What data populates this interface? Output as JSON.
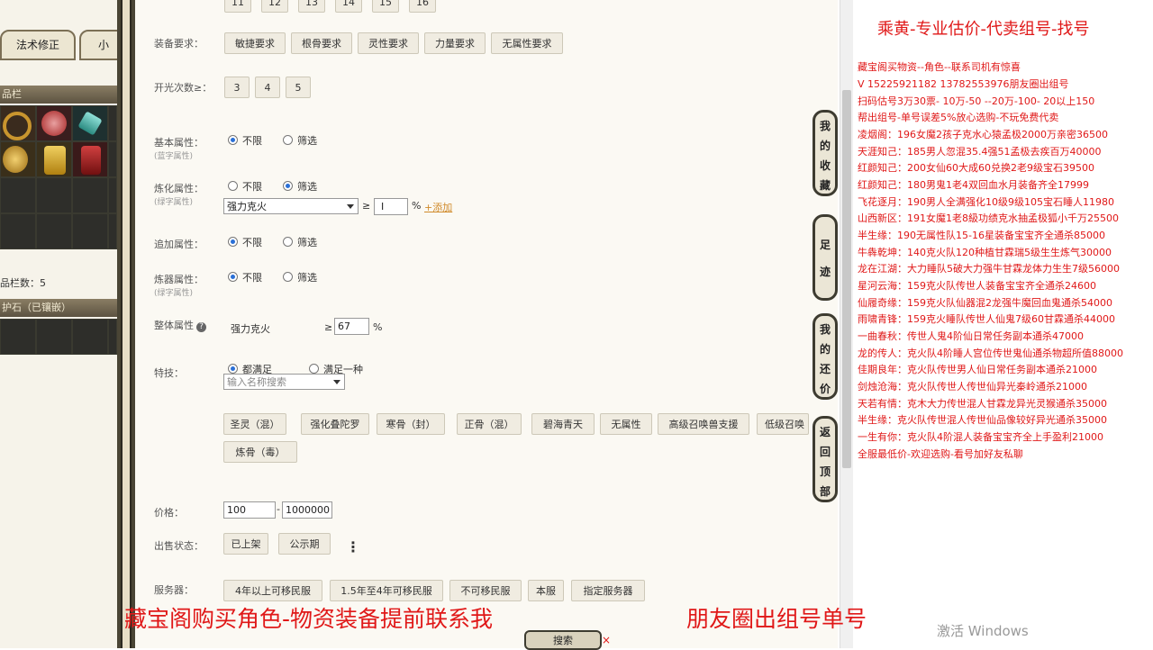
{
  "left_panel": {
    "tab1": "法术修正",
    "tab2": "小",
    "bar1": "品栏",
    "slots_label": "品栏数：5",
    "bar2": "护石（已镶嵌）"
  },
  "form": {
    "top_buttons": [
      "11",
      "12",
      "13",
      "14",
      "15",
      "16"
    ],
    "gear_req": {
      "label": "装备要求：",
      "buttons": [
        "敏捷要求",
        "根骨要求",
        "灵性要求",
        "力量要求",
        "无属性要求"
      ]
    },
    "open_light": {
      "label": "开光次数≥：",
      "buttons": [
        "3",
        "4",
        "5"
      ]
    },
    "basic_attr": {
      "label": "基本属性：",
      "sub": "(蓝字属性)",
      "opt_any": "不限",
      "opt_filter": "筛选"
    },
    "refine_attr": {
      "label": "炼化属性：",
      "sub": "(绿字属性)",
      "opt_any": "不限",
      "opt_filter": "筛选",
      "select_value": "强力克火",
      "ge": "≥",
      "pct": "%",
      "add_link": "+添加"
    },
    "extra_attr": {
      "label": "追加属性：",
      "opt_any": "不限",
      "opt_filter": "筛选"
    },
    "refiner_attr": {
      "label": "炼器属性：",
      "sub": "(绿字属性)",
      "opt_any": "不限",
      "opt_filter": "筛选"
    },
    "overall_attr": {
      "label": "整体属性",
      "help": "?",
      "name": "强力克火",
      "ge": "≥",
      "value": "67",
      "pct": "%"
    },
    "skills": {
      "label": "特技：",
      "opt_all": "都满足",
      "opt_one": "满足一种",
      "search_placeholder": "输入名称搜索",
      "buttons": [
        "圣灵（混）",
        "强化叠陀罗",
        "寒骨（封）",
        "正骨（混）",
        "碧海青天",
        "无属性",
        "高级召唤兽支援",
        "低级召唤",
        "炼骨（毒）"
      ]
    },
    "price": {
      "label": "价格：",
      "min": "100",
      "dash": "-",
      "max": "1000000"
    },
    "sale_status": {
      "label": "出售状态：",
      "buttons": [
        "已上架",
        "公示期"
      ],
      "more": "⋮"
    },
    "server": {
      "label": "服务器：",
      "buttons": [
        "4年以上可移民服",
        "1.5年至4年可移民服",
        "不可移民服",
        "本服",
        "指定服务器"
      ]
    },
    "search": "搜索",
    "search_x": "×"
  },
  "side_nav": [
    {
      "chars": [
        "我",
        "的",
        "收",
        "藏"
      ]
    },
    {
      "chars": [
        "足",
        "迹"
      ]
    },
    {
      "chars": [
        "我",
        "的",
        "还",
        "价"
      ]
    },
    {
      "chars": [
        "返",
        "回",
        "顶",
        "部"
      ]
    }
  ],
  "right_panel": {
    "title": "乘黄-专业估价-代卖组号-找号",
    "lines": [
      "藏宝阁买物资--角色--联系司机有惊喜",
      "V 15225921182  13782553976朋友圈出组号",
      "扫码估号3万30票- 10万-50 --20万-100- 20以上150",
      "帮出组号-单号误差5%放心选购-不玩免费代卖",
      "凌烟阁：196女魔2孩子克水心猿孟极2000万亲密36500",
      "天涯知己：185男人忽混35.4强51孟极去疾百万40000",
      "红颜知己：200女仙60大成60兑换2老9级宝石39500",
      "红颜知己：180男鬼1老4双回血水月装备齐全17999",
      "飞花逐月：190男人全满强化10级9级105宝石睡人11980",
      " 山西新区：191女魔1老8級功绩克水抽孟极狐小千万25500",
      "半生缘：190无属性队15-16星装备宝宝齐全通杀85000",
      "牛犇乾坤：140克火队120种植甘霖瑞5级生生炼气30000",
      "龙在江湖：大力睡队5破大力强牛甘霖龙体力生生7级56000",
      "星河云海：159克火队传世人装备宝宝齐全通杀24600",
      "仙履奇缘：159克火队仙器混2龙强牛魔回血鬼通杀54000",
      "雨啸青锋：159克火睡队传世人仙鬼7级60甘霖通杀44000",
      "一曲春秋：传世人鬼4阶仙日常任务副本通杀47000",
      "龙的传人：克火队4阶睡人宫位传世鬼仙通杀物超所值88000",
      "佳期良年：克火队传世男人仙日常任务副本通杀21000",
      "剑烛沧海：克火队传世人传世仙异光秦岭通杀21000",
      "天若有情：克木大力传世混人甘霖龙异光灵猴通杀35000",
      "半生缘：克火队传世混人传世仙品像较好异光通杀35000",
      "一生有你：克火队4阶混人装备宝宝齐全上手盈利21000",
      "全服最低价-欢迎选购-看号加好友私聊"
    ]
  },
  "caption": {
    "left": "藏宝阁购买角色-物资装备提前联系我",
    "right": "朋友圈出组号单号"
  },
  "watermark": "激活 Windows"
}
